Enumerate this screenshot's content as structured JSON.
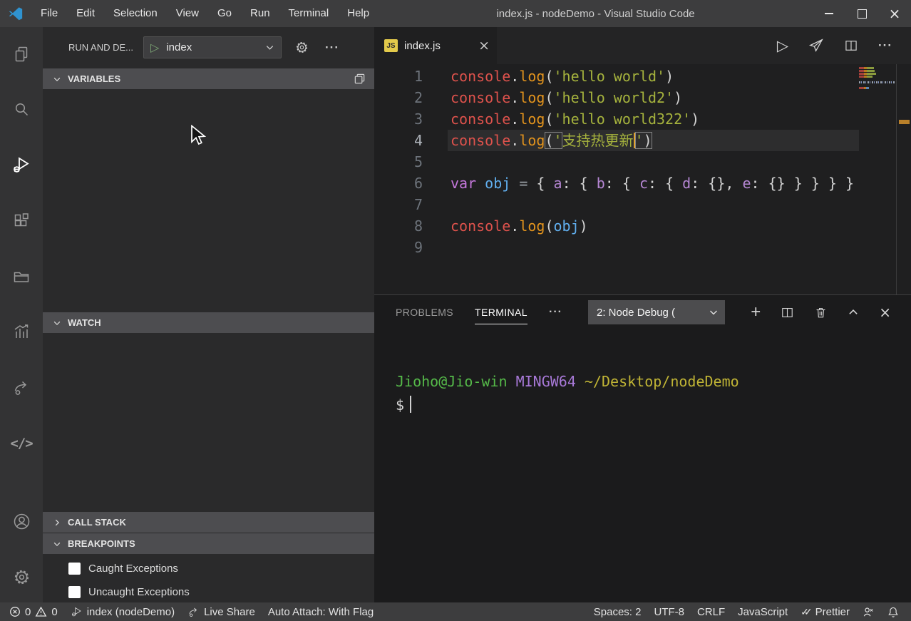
{
  "window": {
    "title": "index.js - nodeDemo - Visual Studio Code",
    "menu": [
      "File",
      "Edit",
      "Selection",
      "View",
      "Go",
      "Run",
      "Terminal",
      "Help"
    ]
  },
  "icons": {
    "play": "▷",
    "more": "···",
    "plus": "+",
    "close": "×",
    "double_check": "✓✓"
  },
  "activity_bar": {
    "items": [
      "explorer",
      "search",
      "run-and-debug",
      "extensions",
      "remote-explorer",
      "insights",
      "live-share",
      "code",
      "account",
      "settings"
    ],
    "active": "run-and-debug"
  },
  "sidebar": {
    "title": "RUN AND DE...",
    "launch_config": "index",
    "sections": {
      "variables": {
        "label": "VARIABLES",
        "state": "expanded"
      },
      "watch": {
        "label": "WATCH",
        "state": "expanded"
      },
      "call_stack": {
        "label": "CALL STACK",
        "state": "collapsed"
      },
      "breakpoints": {
        "label": "BREAKPOINTS",
        "state": "expanded"
      }
    },
    "breakpoint_items": [
      {
        "label": "Caught Exceptions",
        "checked": false
      },
      {
        "label": "Uncaught Exceptions",
        "checked": false
      }
    ]
  },
  "editor": {
    "tab": {
      "label": "index.js"
    },
    "active_line": 4,
    "lines": [
      {
        "n": "1",
        "tokens": [
          {
            "t": "console",
            "c": "red"
          },
          {
            "t": ".",
            "c": "pun"
          },
          {
            "t": "log",
            "c": "fn"
          },
          {
            "t": "(",
            "c": "pun"
          },
          {
            "t": "'hello world'",
            "c": "str"
          },
          {
            "t": ")",
            "c": "pun"
          }
        ]
      },
      {
        "n": "2",
        "tokens": [
          {
            "t": "console",
            "c": "red"
          },
          {
            "t": ".",
            "c": "pun"
          },
          {
            "t": "log",
            "c": "fn"
          },
          {
            "t": "(",
            "c": "pun"
          },
          {
            "t": "'hello world2'",
            "c": "str"
          },
          {
            "t": ")",
            "c": "pun"
          }
        ]
      },
      {
        "n": "3",
        "tokens": [
          {
            "t": "console",
            "c": "red"
          },
          {
            "t": ".",
            "c": "pun"
          },
          {
            "t": "log",
            "c": "fn"
          },
          {
            "t": "(",
            "c": "pun"
          },
          {
            "t": "'hello world322'",
            "c": "str"
          },
          {
            "t": ")",
            "c": "pun"
          }
        ]
      },
      {
        "n": "4",
        "current": true,
        "tokens": [
          {
            "t": "console",
            "c": "red"
          },
          {
            "t": ".",
            "c": "pun"
          },
          {
            "t": "log",
            "c": "fn"
          },
          {
            "box": [
              {
                "t": "(",
                "c": "pun"
              },
              {
                "t": "'",
                "c": "str"
              }
            ]
          },
          {
            "t": "支持热更新",
            "c": "str"
          },
          {
            "cursor": true
          },
          {
            "box": [
              {
                "t": "'",
                "c": "str"
              },
              {
                "t": ")",
                "c": "pun"
              }
            ]
          }
        ]
      },
      {
        "n": "5",
        "tokens": []
      },
      {
        "n": "6",
        "tokens": [
          {
            "t": "var",
            "c": "kw"
          },
          {
            "t": " ",
            "c": "pun"
          },
          {
            "t": "obj",
            "c": "blue"
          },
          {
            "t": " ",
            "c": "pun"
          },
          {
            "t": "=",
            "c": "op"
          },
          {
            "t": " { ",
            "c": "pun"
          },
          {
            "t": "a",
            "c": "prop"
          },
          {
            "t": ": { ",
            "c": "pun"
          },
          {
            "t": "b",
            "c": "prop"
          },
          {
            "t": ": { ",
            "c": "pun"
          },
          {
            "t": "c",
            "c": "prop"
          },
          {
            "t": ": { ",
            "c": "pun"
          },
          {
            "t": "d",
            "c": "prop"
          },
          {
            "t": ": {}, ",
            "c": "pun"
          },
          {
            "t": "e",
            "c": "prop"
          },
          {
            "t": ": {} } } } }",
            "c": "pun"
          }
        ]
      },
      {
        "n": "7",
        "tokens": []
      },
      {
        "n": "8",
        "tokens": [
          {
            "t": "console",
            "c": "red"
          },
          {
            "t": ".",
            "c": "pun"
          },
          {
            "t": "log",
            "c": "fn"
          },
          {
            "t": "(",
            "c": "pun"
          },
          {
            "t": "obj",
            "c": "blue"
          },
          {
            "t": ")",
            "c": "pun"
          }
        ]
      },
      {
        "n": "9",
        "tokens": []
      }
    ]
  },
  "panel": {
    "tabs": [
      {
        "label": "PROBLEMS",
        "active": false
      },
      {
        "label": "TERMINAL",
        "active": true
      }
    ],
    "dropdown_value": "2: Node Debug (",
    "terminal": {
      "lines": [
        [
          {
            "t": "Jioho@Jio-win",
            "c": "tgreen"
          },
          {
            "t": " ",
            "c": "tplain"
          },
          {
            "t": "MINGW64",
            "c": "tpurple"
          },
          {
            "t": " ",
            "c": "tplain"
          },
          {
            "t": "~/Desktop/nodeDemo",
            "c": "tyellow"
          }
        ],
        [
          {
            "t": "$",
            "c": "tplain"
          },
          {
            "cursor": true
          }
        ]
      ]
    }
  },
  "status_bar": {
    "errors": "0",
    "warnings": "0",
    "debug_target": "index (nodeDemo)",
    "live_share_label": "Live Share",
    "auto_attach": "Auto Attach: With Flag",
    "indentation": "Spaces: 2",
    "encoding": "UTF-8",
    "eol": "CRLF",
    "language": "JavaScript",
    "formatter": "Prettier"
  },
  "colors": {
    "titlebar": "#3d3d3e",
    "activity_bar": "#333334",
    "sidebar": "#2a2a2b",
    "section_header": "#4d4d50",
    "editor_bg": "#1f1f20",
    "terminal_bg": "#1b1b1c",
    "statusbar": "#3d3d3e",
    "accent_orange_caret": "#e0a22e",
    "js_badge": "#e3ca4b",
    "code_red": "#de524c",
    "code_orange": "#e2931d",
    "code_string": "#a5b23d",
    "code_keyword": "#c678dd",
    "code_variable": "#61afef",
    "term_green": "#55b949",
    "term_purple": "#a879d8",
    "term_yellow": "#c0b435"
  }
}
